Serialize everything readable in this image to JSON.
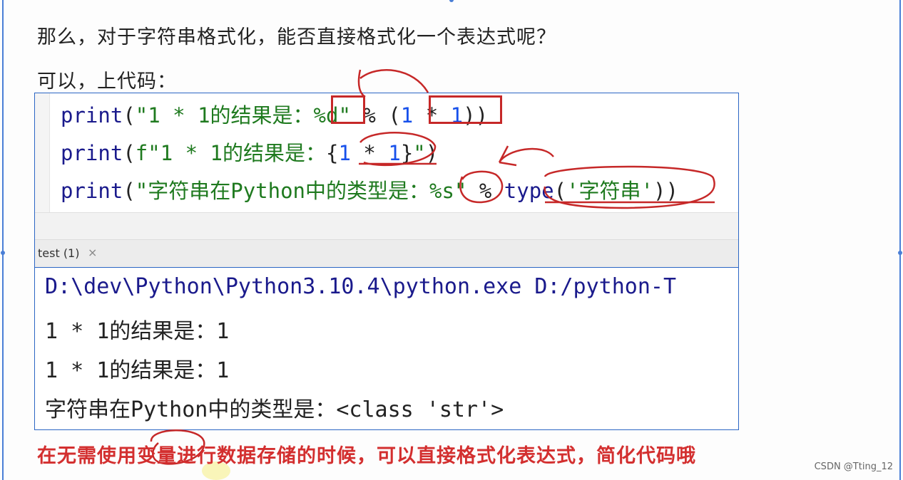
{
  "heading1": "那么，对于字符串格式化，能否直接格式化一个表达式呢？",
  "heading2": "可以，上代码：",
  "code": {
    "l1": {
      "kw": "print",
      "p1": "(",
      "s1": "\"1 * 1的结果是：",
      "fmt": "%d",
      "s2": "\"",
      "op": " % (",
      "n1": "1",
      "op2": " * ",
      "n2": "1",
      "p2": "))"
    },
    "l2": {
      "kw": "print",
      "p1": "(",
      "fpre": "f",
      "s1": "\"1 * 1的结果是：",
      "br1": "{",
      "n1": "1",
      "op": " * ",
      "n2": "1",
      "br2": "}",
      "s2": "\"",
      "p2": ")"
    },
    "l3": {
      "kw": "print",
      "p1": "(",
      "s1": "\"字符串在Python中的类型是：",
      "fmt": "%s",
      "s2": "\"",
      "op": " % ",
      "fn": "type",
      "p2": "(",
      "s3": "'字符串'",
      "p3": "))"
    }
  },
  "tab": {
    "label": "test (1)",
    "close": "×"
  },
  "output": [
    "D:\\dev\\Python\\Python3.10.4\\python.exe D:/python-T",
    "1 * 1的结果是：1",
    "1 * 1的结果是：1",
    "字符串在Python中的类型是：<class 'str'>"
  ],
  "footer": "在无需使用变量进行数据存储的时候，可以直接格式化表达式，简化代码哦",
  "watermark": "CSDN @Tting_12",
  "colors": {
    "annotation": "#c62828",
    "frame": "#2b66c4"
  }
}
